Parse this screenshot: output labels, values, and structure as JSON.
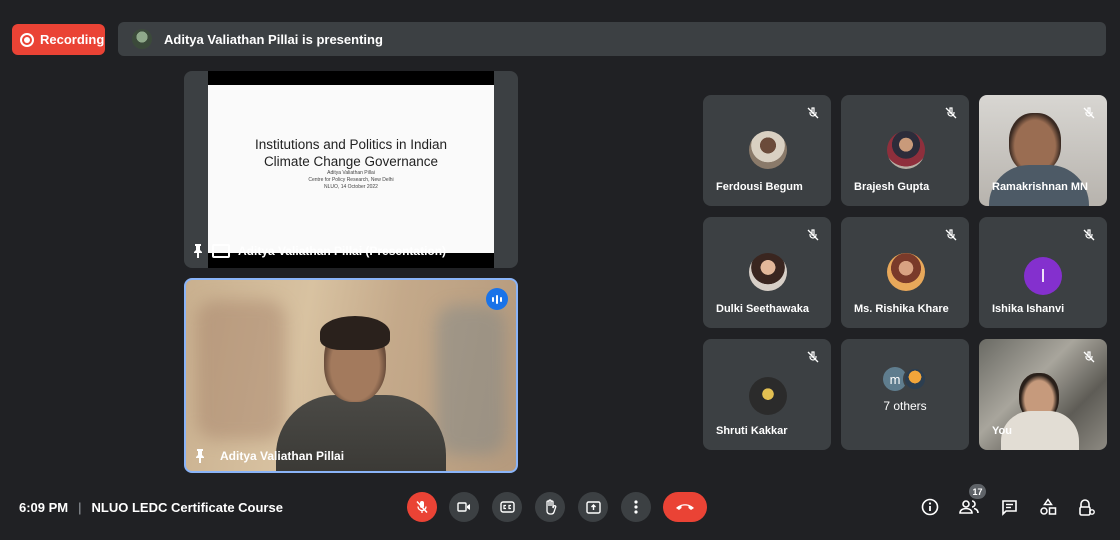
{
  "recording": {
    "label": "Recording"
  },
  "presenting_bar": {
    "text": "Aditya Valiathan Pillai is presenting"
  },
  "presentation": {
    "slide_title": "Institutions and Politics in Indian Climate Change Governance",
    "slide_lines": [
      "Aditya Valiathan Pillai",
      "Centre for Policy Research, New Delhi",
      "NLUO, 14 October 2022"
    ],
    "label": "Aditya Valiathan Pillai (Presentation)"
  },
  "speaker": {
    "name": "Aditya Valiathan Pillai"
  },
  "participants": [
    {
      "name": "Ferdousi Begum"
    },
    {
      "name": "Brajesh Gupta"
    },
    {
      "name": "Ramakrishnan MN"
    },
    {
      "name": "Dulki Seethawaka"
    },
    {
      "name": "Ms. Rishika Khare"
    },
    {
      "name": "Ishika Ishanvi",
      "initial": "I"
    },
    {
      "name": "Shruti Kakkar"
    },
    {
      "others_initial": "m",
      "others_label": "7 others"
    },
    {
      "name": "You"
    }
  ],
  "bottom": {
    "time": "6:09 PM",
    "separator": "|",
    "meeting_name": "NLUO LEDC Certificate Course",
    "people_count": "17"
  },
  "colors": {
    "accent_red": "#ea4335",
    "accent_blue": "#8ab4f8",
    "tile_bg": "#3c4043",
    "page_bg": "#202124"
  }
}
